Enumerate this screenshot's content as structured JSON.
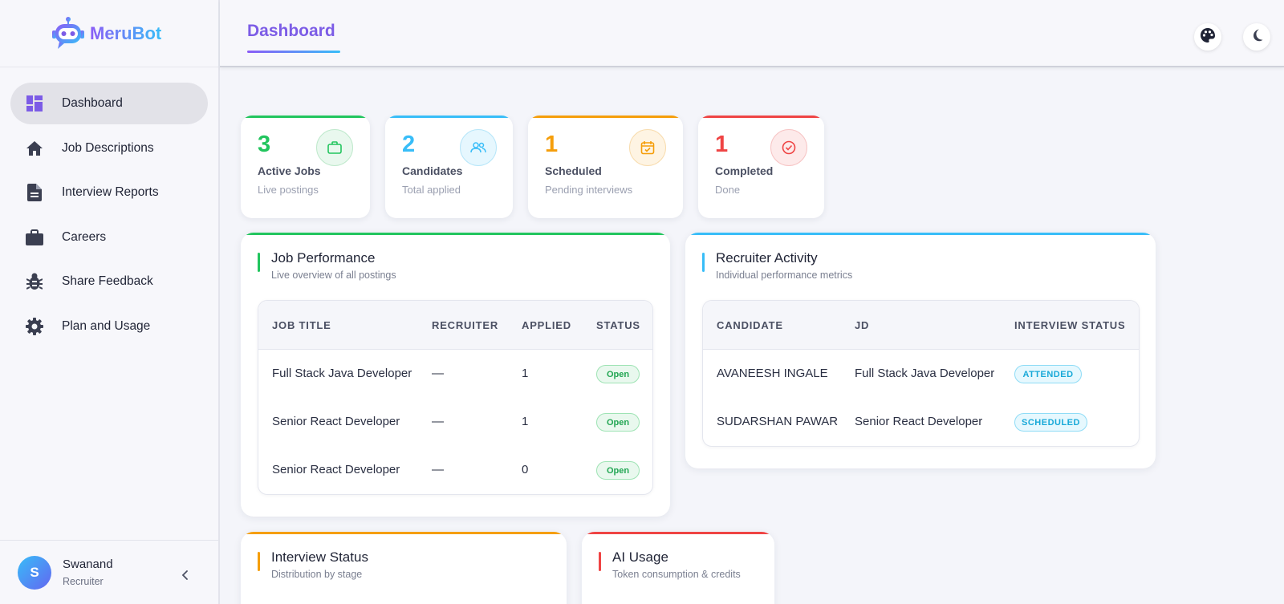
{
  "brand": {
    "name": "MeruBot"
  },
  "sidebar": {
    "items": [
      {
        "label": "Dashboard",
        "icon": "dashboard-icon",
        "active": true
      },
      {
        "label": "Job Descriptions",
        "icon": "home-icon"
      },
      {
        "label": "Interview Reports",
        "icon": "document-icon"
      },
      {
        "label": "Careers",
        "icon": "briefcase-icon"
      },
      {
        "label": "Share Feedback",
        "icon": "bug-icon"
      },
      {
        "label": "Plan and Usage",
        "icon": "gear-icon"
      }
    ]
  },
  "user": {
    "initial": "S",
    "name": "Swanand",
    "role": "Recruiter"
  },
  "header": {
    "title": "Dashboard"
  },
  "stats": [
    {
      "value": "3",
      "label": "Active Jobs",
      "sub": "Live postings",
      "color": "#22c55e",
      "icon": "briefcase-icon"
    },
    {
      "value": "2",
      "label": "Candidates",
      "sub": "Total applied",
      "color": "#38bdf8",
      "icon": "users-icon"
    },
    {
      "value": "1",
      "label": "Scheduled",
      "sub": "Pending interviews",
      "color": "#f59e0b",
      "icon": "calendar-check-icon"
    },
    {
      "value": "1",
      "label": "Completed",
      "sub": "Done",
      "color": "#ef4444",
      "icon": "check-circle-icon"
    }
  ],
  "job_performance": {
    "title": "Job Performance",
    "subtitle": "Live overview of all postings",
    "columns": [
      "JOB TITLE",
      "RECRUITER",
      "APPLIED",
      "STATUS"
    ],
    "rows": [
      {
        "title": "Full Stack Java Developer",
        "recruiter": "—",
        "applied": "1",
        "status": "Open"
      },
      {
        "title": "Senior React Developer",
        "recruiter": "—",
        "applied": "1",
        "status": "Open"
      },
      {
        "title": "Senior React Developer",
        "recruiter": "—",
        "applied": "0",
        "status": "Open"
      }
    ]
  },
  "recruiter_activity": {
    "title": "Recruiter Activity",
    "subtitle": "Individual performance metrics",
    "columns": [
      "CANDIDATE",
      "JD",
      "INTERVIEW STATUS"
    ],
    "rows": [
      {
        "candidate": "AVANEESH INGALE",
        "jd": "Full Stack Java Developer",
        "status": "ATTENDED"
      },
      {
        "candidate": "SUDARSHAN PAWAR",
        "jd": "Senior React Developer",
        "status": "SCHEDULED"
      }
    ]
  },
  "interview_status": {
    "title": "Interview Status",
    "subtitle": "Distribution by stage"
  },
  "ai_usage": {
    "title": "AI Usage",
    "subtitle": "Token consumption & credits"
  },
  "colors": {
    "accent": "#7c5ce6",
    "green": "#22c55e",
    "blue": "#38bdf8",
    "orange": "#f59e0b",
    "red": "#ef4444"
  }
}
